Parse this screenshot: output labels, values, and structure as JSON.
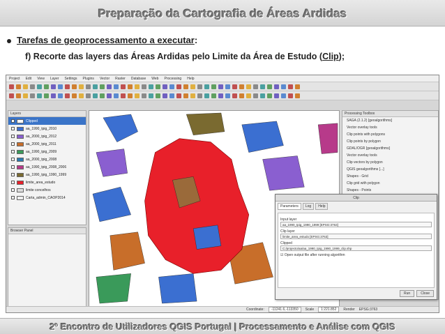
{
  "slide": {
    "title": "Preparação da Cartografia de Áreas Ardidas",
    "bullet_underlined": "Tarefas de geoprocessamento a executar",
    "bullet_suffix": ":",
    "sub_prefix": "f)  Recorte das layers das Áreas Ardidas pelo Limite da Área de Estudo (",
    "sub_underlined": "Clip",
    "sub_suffix": ");",
    "footer": "2º Encontro de Utilizadores QGIS Portugal  |  Processamento e Análise com QGIS"
  },
  "qgis": {
    "menu": [
      "Project",
      "Edit",
      "View",
      "Layer",
      "Settings",
      "Plugins",
      "Vector",
      "Raster",
      "Database",
      "Web",
      "Processing",
      "Help"
    ],
    "layers_title": "Layers",
    "layers": [
      {
        "label": "Clipped",
        "color": "#ffffff",
        "selected": true
      },
      {
        "label": "aa_1990_tpig_2010",
        "color": "#3b6fd1",
        "selected": false
      },
      {
        "label": "aa_2000_tpig_2012",
        "color": "#8a5fd0",
        "selected": false
      },
      {
        "label": "aa_2000_tpig_2011",
        "color": "#c86e2a",
        "selected": false
      },
      {
        "label": "aa_1990_tpig_2009",
        "color": "#3a9a5a",
        "selected": false
      },
      {
        "label": "aa_2000_tpig_2008",
        "color": "#2a7ab0",
        "selected": false
      },
      {
        "label": "aa_1990_tpig_2008_2006",
        "color": "#b73a8a",
        "selected": false
      },
      {
        "label": "aa_1990_tpig_1990_1999",
        "color": "#7a6a30",
        "selected": false
      },
      {
        "label": "limite_area_estudo",
        "color": "#e8202a",
        "selected": false
      },
      {
        "label": "limite concelhos",
        "color": "#dddddd",
        "selected": false
      },
      {
        "label": "Carta_admin_CAOP2014",
        "color": "#f0f0f0",
        "selected": false
      }
    ],
    "browser_title": "Browser Panel",
    "processing_title": "Processing Toolbox",
    "processing_items": [
      "SAGA (2.1.2) [geoalgorithms]",
      "Vector overlay tools",
      "Clip points with polygons",
      "Clip points by polygon",
      "GDAL/OGR [geoalgorithms]",
      "Vector overlay tools",
      "Clip vectors by polygon",
      "QGIS geoalgorithms [...]",
      "Shapes - Grid",
      "Clip grid with polygon",
      "Shapes - Points",
      "Clip points with polygons"
    ],
    "dialog": {
      "title": "Clip",
      "tabs": [
        "Parameters",
        "Log",
        "Help"
      ],
      "input_label": "Input layer",
      "input_value": "aa_1990_tpig_1990_1999 [EPSG:3763]",
      "clip_label": "Clip layer",
      "clip_value": "limite_area_estudo [EPSG:3763]",
      "output_label": "Clipped",
      "output_value": "C:/projecto/aa/aa_1990_tpig_1990_1999_clip.shp",
      "checkbox_label": "Open output file after running algorithm",
      "run_label": "Run",
      "close_label": "Close"
    },
    "status": {
      "coordinate_label": "Coordinate:",
      "coordinate": "-11241.6,-113350",
      "scale_label": "Scale",
      "scale": "1:221.852",
      "render_label": "Render",
      "crs": "EPSG:3763"
    }
  }
}
